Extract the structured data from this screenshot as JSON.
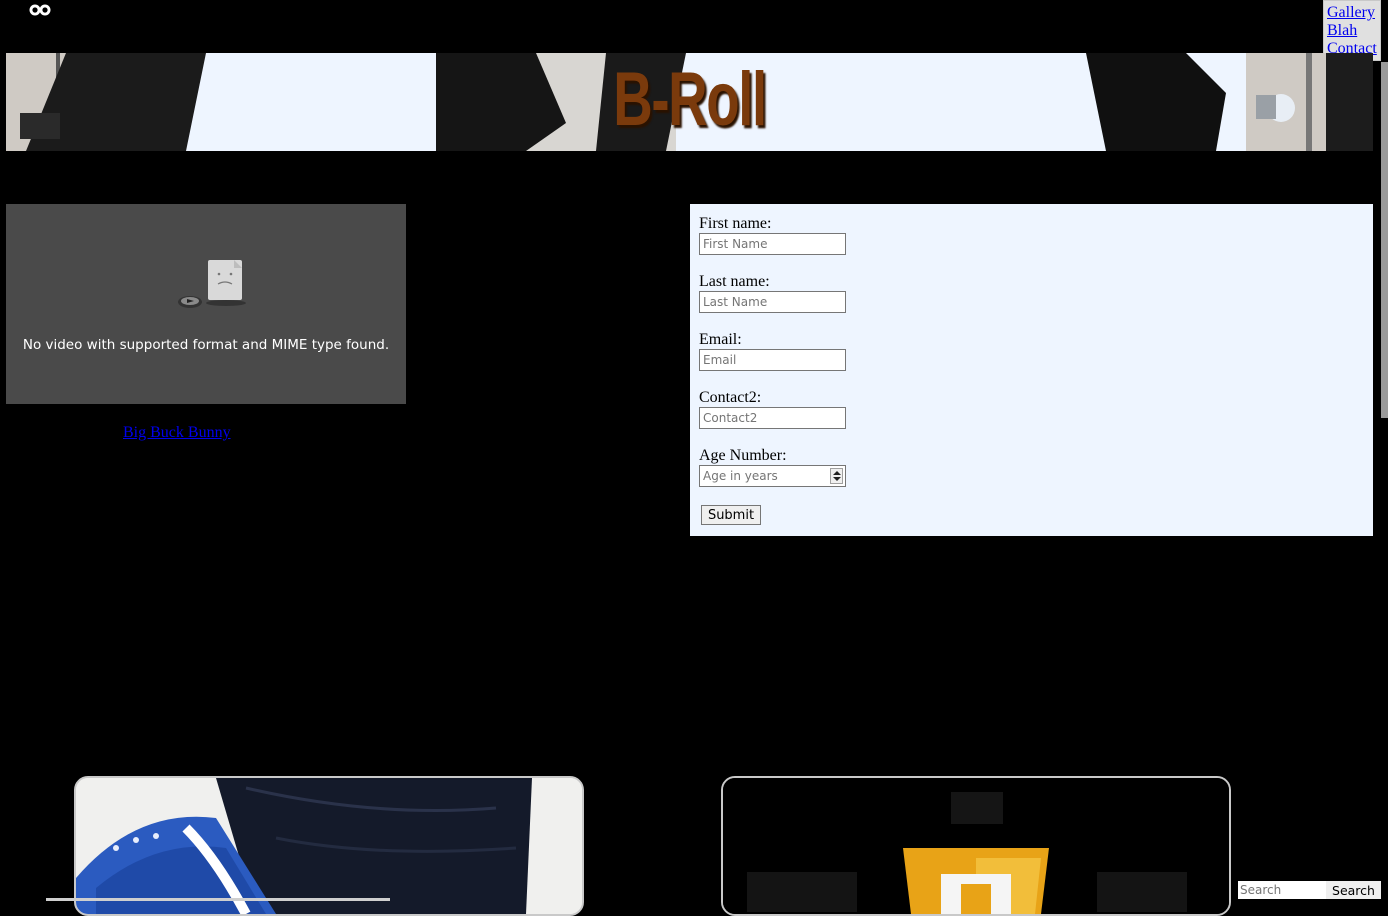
{
  "nav": {
    "items": [
      {
        "label": "Gallery"
      },
      {
        "label": "Blah"
      },
      {
        "label": "Contact"
      }
    ],
    "link_color": "#0000ee"
  },
  "banner": {
    "title": "B-Roll",
    "title_color": "#7a3a0c"
  },
  "video": {
    "error_message": "No video with supported format and MIME type found.",
    "link_label": "Big Buck Bunny"
  },
  "form": {
    "fields": [
      {
        "label": "First name:",
        "placeholder": "First Name",
        "value": ""
      },
      {
        "label": "Last name:",
        "placeholder": "Last Name",
        "value": ""
      },
      {
        "label": "Email:",
        "placeholder": "Email",
        "value": ""
      },
      {
        "label": "Contact2:",
        "placeholder": "Contact2",
        "value": ""
      }
    ],
    "age": {
      "label": "Age Number:",
      "placeholder": "Age in years",
      "value": ""
    },
    "submit_label": "Submit",
    "background": "#eef5ff"
  },
  "search": {
    "placeholder": "Search",
    "button_label": "Search"
  },
  "icons": {
    "logo": "infinity-icon",
    "video_error": "broken-file-icon"
  }
}
